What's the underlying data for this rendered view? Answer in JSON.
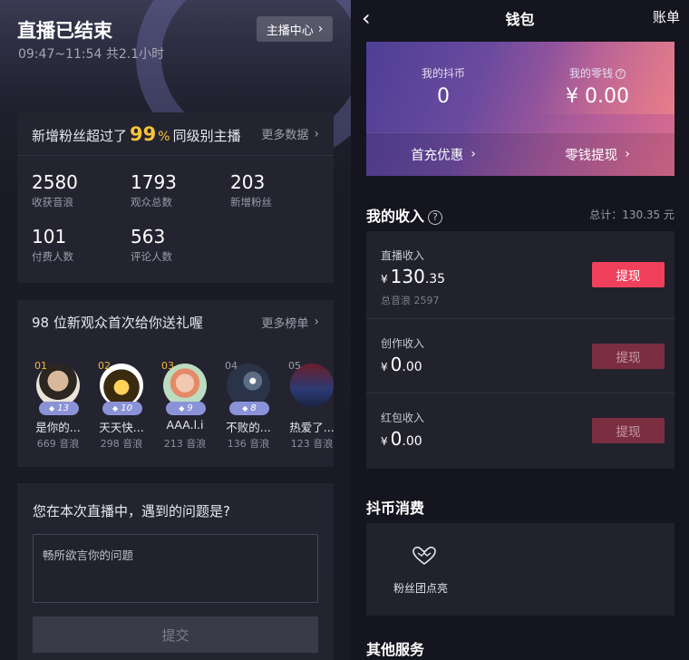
{
  "live_summary": {
    "title": "直播已结束",
    "subtitle": "09:47~11:54 共2.1小时",
    "host_center_label": "主播中心"
  },
  "fans_card": {
    "title_prefix": "新增粉丝超过了",
    "percent_value": "99",
    "percent_sign": "%",
    "title_suffix": "同级别主播",
    "more_label": "更多数据",
    "stats": [
      {
        "value": "2580",
        "label": "收获音浪"
      },
      {
        "value": "1793",
        "label": "观众总数"
      },
      {
        "value": "203",
        "label": "新增粉丝"
      },
      {
        "value": "101",
        "label": "付费人数"
      },
      {
        "value": "563",
        "label": "评论人数"
      }
    ]
  },
  "gift_card": {
    "title": "98 位新观众首次给你送礼喔",
    "more_label": "更多榜单",
    "viewers": [
      {
        "rank": "01",
        "level": "13",
        "name": "是你的...",
        "sub": "669 音浪"
      },
      {
        "rank": "02",
        "level": "10",
        "name": "天天快...",
        "sub": "298 音浪"
      },
      {
        "rank": "03",
        "level": "9",
        "name": "AAA.l.i",
        "sub": "213 音浪"
      },
      {
        "rank": "04",
        "level": "8",
        "name": "不败的...",
        "sub": "136 音浪"
      },
      {
        "rank": "05",
        "level": "",
        "name": "热爱了...",
        "sub": "123 音浪"
      }
    ]
  },
  "feedback": {
    "question": "您在本次直播中，遇到的问题是?",
    "placeholder": "畅所欲言你的问题",
    "submit_label": "提交"
  },
  "wallet": {
    "title": "钱包",
    "bill_label": "账单",
    "coins_label": "我的抖币",
    "coins_value": "0",
    "change_label": "我的零钱",
    "change_value": "¥ 0.00",
    "first_recharge_label": "首充优惠",
    "withdraw_change_label": "零钱提现"
  },
  "income": {
    "title": "我的收入",
    "total": "总计：130.35 元",
    "rows": [
      {
        "label": "直播收入",
        "currency": "¥",
        "int": "130",
        "dec": ".35",
        "sub": "总音浪 2597",
        "button": "提现",
        "active": true
      },
      {
        "label": "创作收入",
        "currency": "¥",
        "int": "0",
        "dec": ".00",
        "sub": "",
        "button": "提现",
        "active": false
      },
      {
        "label": "红包收入",
        "currency": "¥",
        "int": "0",
        "dec": ".00",
        "sub": "",
        "button": "提现",
        "active": false
      }
    ]
  },
  "coin_consume": {
    "title": "抖币消费",
    "item_label": "粉丝团点亮"
  },
  "other_services": {
    "title": "其他服务"
  }
}
